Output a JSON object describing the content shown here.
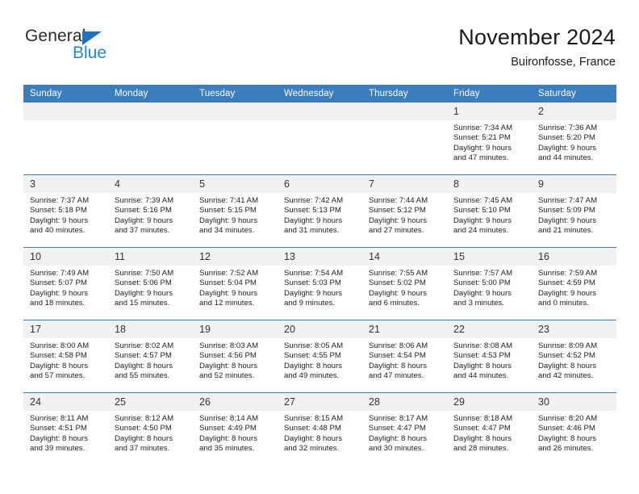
{
  "logo": {
    "word1": "General",
    "word2": "Blue",
    "triangle_color": "#1f72bd",
    "word2_color": "#1f86d0"
  },
  "header": {
    "title": "November 2024",
    "subtitle": "Buironfosse, France"
  },
  "theme": {
    "header_blue": "#3a7ec0",
    "daynum_bg": "#f1f1f1"
  },
  "calendar": {
    "weekdays": [
      "Sunday",
      "Monday",
      "Tuesday",
      "Wednesday",
      "Thursday",
      "Friday",
      "Saturday"
    ],
    "weeks": [
      [
        {
          "day": "",
          "empty": true
        },
        {
          "day": "",
          "empty": true
        },
        {
          "day": "",
          "empty": true
        },
        {
          "day": "",
          "empty": true
        },
        {
          "day": "",
          "empty": true
        },
        {
          "day": "1",
          "sunrise": "Sunrise: 7:34 AM",
          "sunset": "Sunset: 5:21 PM",
          "daylight1": "Daylight: 9 hours",
          "daylight2": "and 47 minutes."
        },
        {
          "day": "2",
          "sunrise": "Sunrise: 7:36 AM",
          "sunset": "Sunset: 5:20 PM",
          "daylight1": "Daylight: 9 hours",
          "daylight2": "and 44 minutes."
        }
      ],
      [
        {
          "day": "3",
          "sunrise": "Sunrise: 7:37 AM",
          "sunset": "Sunset: 5:18 PM",
          "daylight1": "Daylight: 9 hours",
          "daylight2": "and 40 minutes."
        },
        {
          "day": "4",
          "sunrise": "Sunrise: 7:39 AM",
          "sunset": "Sunset: 5:16 PM",
          "daylight1": "Daylight: 9 hours",
          "daylight2": "and 37 minutes."
        },
        {
          "day": "5",
          "sunrise": "Sunrise: 7:41 AM",
          "sunset": "Sunset: 5:15 PM",
          "daylight1": "Daylight: 9 hours",
          "daylight2": "and 34 minutes."
        },
        {
          "day": "6",
          "sunrise": "Sunrise: 7:42 AM",
          "sunset": "Sunset: 5:13 PM",
          "daylight1": "Daylight: 9 hours",
          "daylight2": "and 31 minutes."
        },
        {
          "day": "7",
          "sunrise": "Sunrise: 7:44 AM",
          "sunset": "Sunset: 5:12 PM",
          "daylight1": "Daylight: 9 hours",
          "daylight2": "and 27 minutes."
        },
        {
          "day": "8",
          "sunrise": "Sunrise: 7:45 AM",
          "sunset": "Sunset: 5:10 PM",
          "daylight1": "Daylight: 9 hours",
          "daylight2": "and 24 minutes."
        },
        {
          "day": "9",
          "sunrise": "Sunrise: 7:47 AM",
          "sunset": "Sunset: 5:09 PM",
          "daylight1": "Daylight: 9 hours",
          "daylight2": "and 21 minutes."
        }
      ],
      [
        {
          "day": "10",
          "sunrise": "Sunrise: 7:49 AM",
          "sunset": "Sunset: 5:07 PM",
          "daylight1": "Daylight: 9 hours",
          "daylight2": "and 18 minutes."
        },
        {
          "day": "11",
          "sunrise": "Sunrise: 7:50 AM",
          "sunset": "Sunset: 5:06 PM",
          "daylight1": "Daylight: 9 hours",
          "daylight2": "and 15 minutes."
        },
        {
          "day": "12",
          "sunrise": "Sunrise: 7:52 AM",
          "sunset": "Sunset: 5:04 PM",
          "daylight1": "Daylight: 9 hours",
          "daylight2": "and 12 minutes."
        },
        {
          "day": "13",
          "sunrise": "Sunrise: 7:54 AM",
          "sunset": "Sunset: 5:03 PM",
          "daylight1": "Daylight: 9 hours",
          "daylight2": "and 9 minutes."
        },
        {
          "day": "14",
          "sunrise": "Sunrise: 7:55 AM",
          "sunset": "Sunset: 5:02 PM",
          "daylight1": "Daylight: 9 hours",
          "daylight2": "and 6 minutes."
        },
        {
          "day": "15",
          "sunrise": "Sunrise: 7:57 AM",
          "sunset": "Sunset: 5:00 PM",
          "daylight1": "Daylight: 9 hours",
          "daylight2": "and 3 minutes."
        },
        {
          "day": "16",
          "sunrise": "Sunrise: 7:59 AM",
          "sunset": "Sunset: 4:59 PM",
          "daylight1": "Daylight: 9 hours",
          "daylight2": "and 0 minutes."
        }
      ],
      [
        {
          "day": "17",
          "sunrise": "Sunrise: 8:00 AM",
          "sunset": "Sunset: 4:58 PM",
          "daylight1": "Daylight: 8 hours",
          "daylight2": "and 57 minutes."
        },
        {
          "day": "18",
          "sunrise": "Sunrise: 8:02 AM",
          "sunset": "Sunset: 4:57 PM",
          "daylight1": "Daylight: 8 hours",
          "daylight2": "and 55 minutes."
        },
        {
          "day": "19",
          "sunrise": "Sunrise: 8:03 AM",
          "sunset": "Sunset: 4:56 PM",
          "daylight1": "Daylight: 8 hours",
          "daylight2": "and 52 minutes."
        },
        {
          "day": "20",
          "sunrise": "Sunrise: 8:05 AM",
          "sunset": "Sunset: 4:55 PM",
          "daylight1": "Daylight: 8 hours",
          "daylight2": "and 49 minutes."
        },
        {
          "day": "21",
          "sunrise": "Sunrise: 8:06 AM",
          "sunset": "Sunset: 4:54 PM",
          "daylight1": "Daylight: 8 hours",
          "daylight2": "and 47 minutes."
        },
        {
          "day": "22",
          "sunrise": "Sunrise: 8:08 AM",
          "sunset": "Sunset: 4:53 PM",
          "daylight1": "Daylight: 8 hours",
          "daylight2": "and 44 minutes."
        },
        {
          "day": "23",
          "sunrise": "Sunrise: 8:09 AM",
          "sunset": "Sunset: 4:52 PM",
          "daylight1": "Daylight: 8 hours",
          "daylight2": "and 42 minutes."
        }
      ],
      [
        {
          "day": "24",
          "sunrise": "Sunrise: 8:11 AM",
          "sunset": "Sunset: 4:51 PM",
          "daylight1": "Daylight: 8 hours",
          "daylight2": "and 39 minutes."
        },
        {
          "day": "25",
          "sunrise": "Sunrise: 8:12 AM",
          "sunset": "Sunset: 4:50 PM",
          "daylight1": "Daylight: 8 hours",
          "daylight2": "and 37 minutes."
        },
        {
          "day": "26",
          "sunrise": "Sunrise: 8:14 AM",
          "sunset": "Sunset: 4:49 PM",
          "daylight1": "Daylight: 8 hours",
          "daylight2": "and 35 minutes."
        },
        {
          "day": "27",
          "sunrise": "Sunrise: 8:15 AM",
          "sunset": "Sunset: 4:48 PM",
          "daylight1": "Daylight: 8 hours",
          "daylight2": "and 32 minutes."
        },
        {
          "day": "28",
          "sunrise": "Sunrise: 8:17 AM",
          "sunset": "Sunset: 4:47 PM",
          "daylight1": "Daylight: 8 hours",
          "daylight2": "and 30 minutes."
        },
        {
          "day": "29",
          "sunrise": "Sunrise: 8:18 AM",
          "sunset": "Sunset: 4:47 PM",
          "daylight1": "Daylight: 8 hours",
          "daylight2": "and 28 minutes."
        },
        {
          "day": "30",
          "sunrise": "Sunrise: 8:20 AM",
          "sunset": "Sunset: 4:46 PM",
          "daylight1": "Daylight: 8 hours",
          "daylight2": "and 26 minutes."
        }
      ]
    ]
  }
}
